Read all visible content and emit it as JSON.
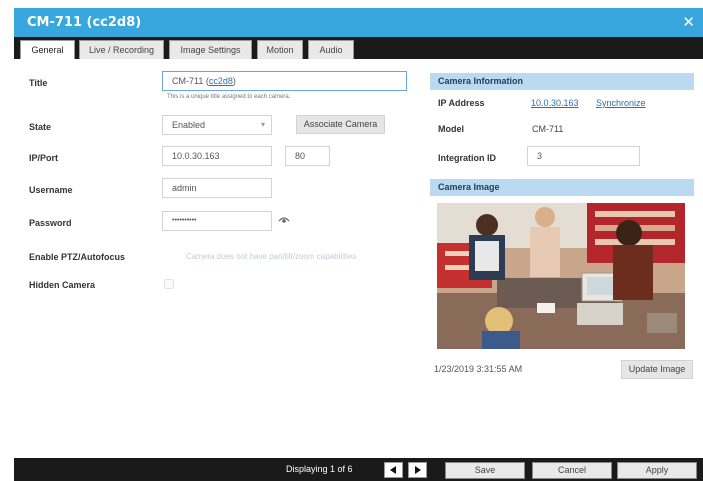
{
  "window": {
    "title": "CM-711 (cc2d8)",
    "close_icon": "close-icon"
  },
  "tabs": [
    {
      "label": "General",
      "active": true
    },
    {
      "label": "Live / Recording"
    },
    {
      "label": "Image Settings"
    },
    {
      "label": "Motion"
    },
    {
      "label": "Audio"
    }
  ],
  "form": {
    "title": {
      "label": "Title",
      "value_prefix": "CM-711 (",
      "value_link": "cc2d8",
      "value_suffix": ")",
      "hint": "This is a unique title assigned to each camera."
    },
    "state": {
      "label": "State",
      "value": "Enabled",
      "associate_button": "Associate Camera"
    },
    "ip_port": {
      "label": "IP/Port",
      "ip": "10.0.30.163",
      "port": "80"
    },
    "username": {
      "label": "Username",
      "value": "admin"
    },
    "password": {
      "label": "Password",
      "value": "••••••••••"
    },
    "ptz": {
      "label": "Enable PTZ/Autofocus",
      "note": "Camera does not have pan/tilt/zoom capabilities"
    },
    "hidden": {
      "label": "Hidden Camera",
      "checked": false
    }
  },
  "camera_info": {
    "header": "Camera Information",
    "ip_label": "IP Address",
    "ip_value": "10.0.30.163",
    "sync_link": "Synchronize",
    "model_label": "Model",
    "model_value": "CM-711",
    "integration_label": "Integration ID",
    "integration_value": "3"
  },
  "camera_image": {
    "header": "Camera Image",
    "timestamp": "1/23/2019 3:31:55 AM",
    "update_button": "Update Image"
  },
  "footer": {
    "paging": "Displaying 1 of 6",
    "save": "Save",
    "cancel": "Cancel",
    "apply": "Apply"
  }
}
